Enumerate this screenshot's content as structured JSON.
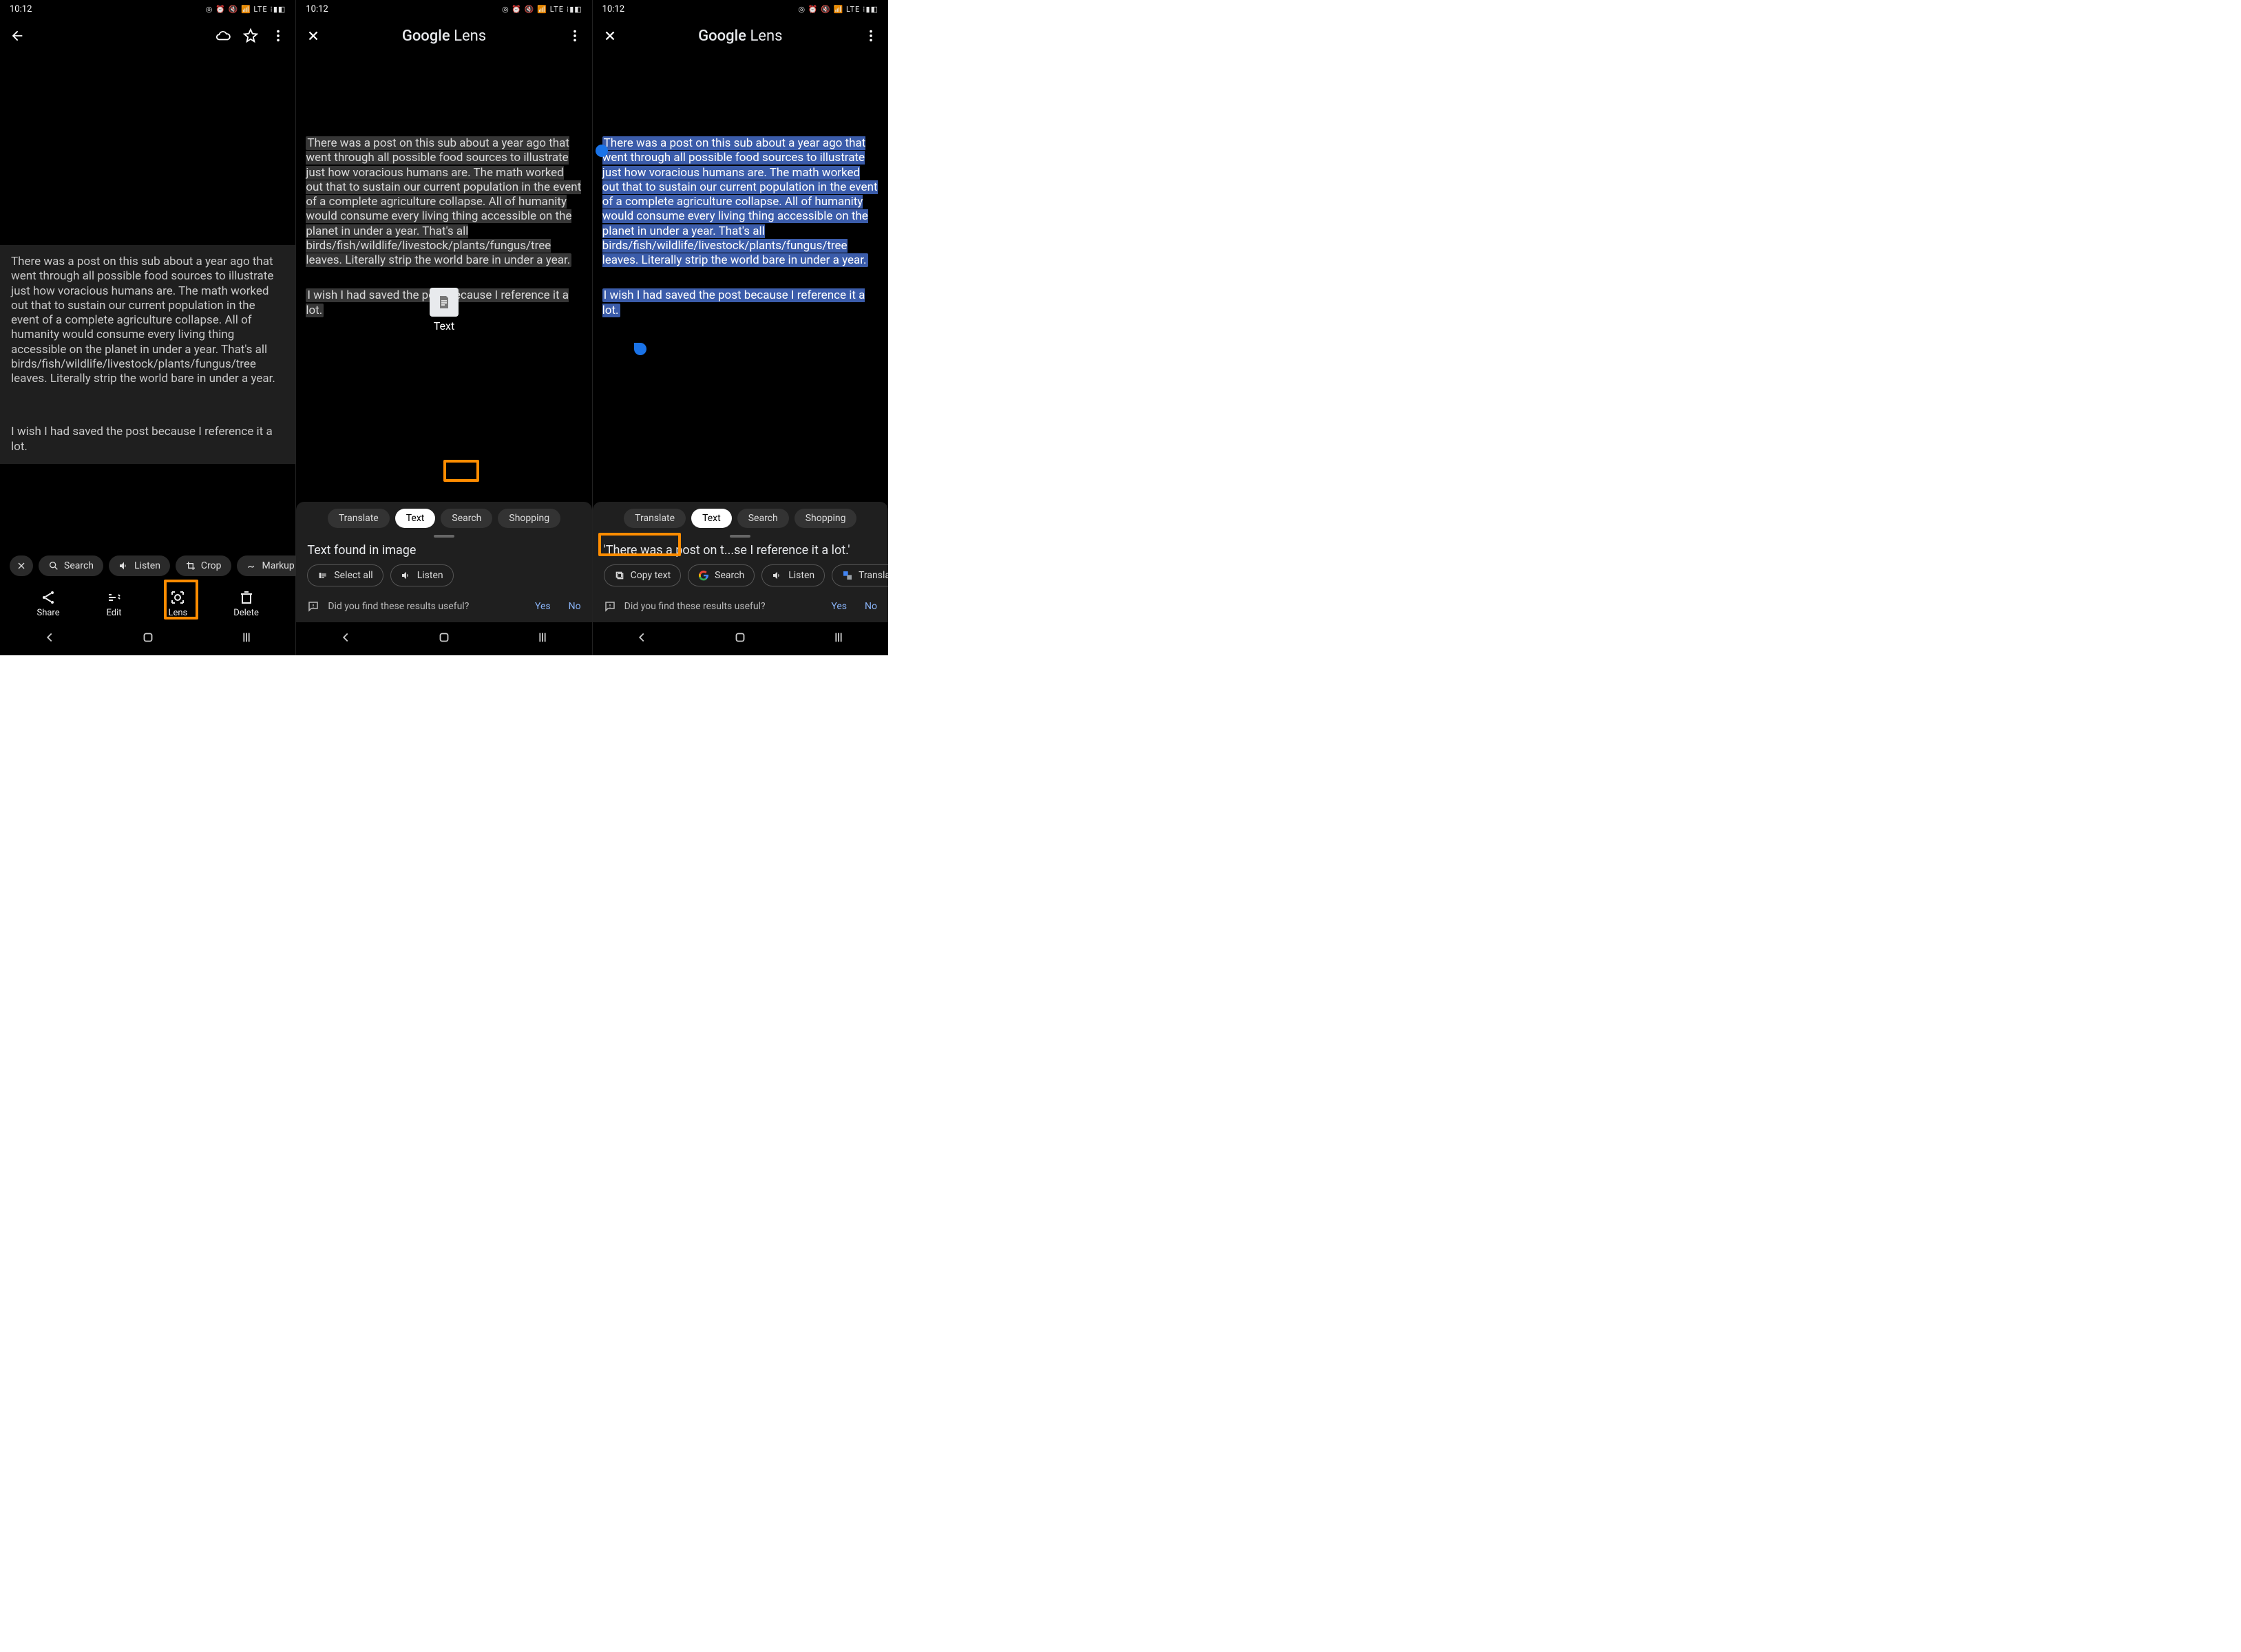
{
  "status": {
    "time": "10:12",
    "icons": "◎ ⏰ 🔇 📶 LTE ⁝▮◧"
  },
  "gallery": {
    "chips": {
      "search": "Search",
      "listen": "Listen",
      "crop": "Crop",
      "markup": "Markup"
    },
    "bottom": {
      "share": "Share",
      "edit": "Edit",
      "lens": "Lens",
      "delete": "Delete"
    }
  },
  "content": {
    "para1": "There was a post on this sub about a year ago that went through all possible food sources to illustrate just how voracious humans are. The math worked out that to sustain our current population in the event of a complete agriculture collapse. All of humanity would consume every living thing accessible on the planet in under a year. That's all birds/fish/wildlife/livestock/plants/fungus/tree leaves. Literally strip the world bare in under a year.",
    "para2": "I wish I had saved the post because I reference it a lot."
  },
  "lens": {
    "title_prefix": "Google",
    "title_suffix": " Lens",
    "overlay_label": "Text",
    "modes": {
      "translate": "Translate",
      "text": "Text",
      "search": "Search",
      "shopping": "Shopping"
    },
    "sheet2_title": "Text found in image",
    "sheet3_title": "'There was a post on t...se I reference it a lot.'",
    "actions2": {
      "selectall": "Select all",
      "listen": "Listen"
    },
    "actions3": {
      "copy": "Copy text",
      "search": "Search",
      "listen": "Listen",
      "translate": "Transla"
    },
    "feedback": {
      "q": "Did you find these results useful?",
      "yes": "Yes",
      "no": "No"
    }
  }
}
